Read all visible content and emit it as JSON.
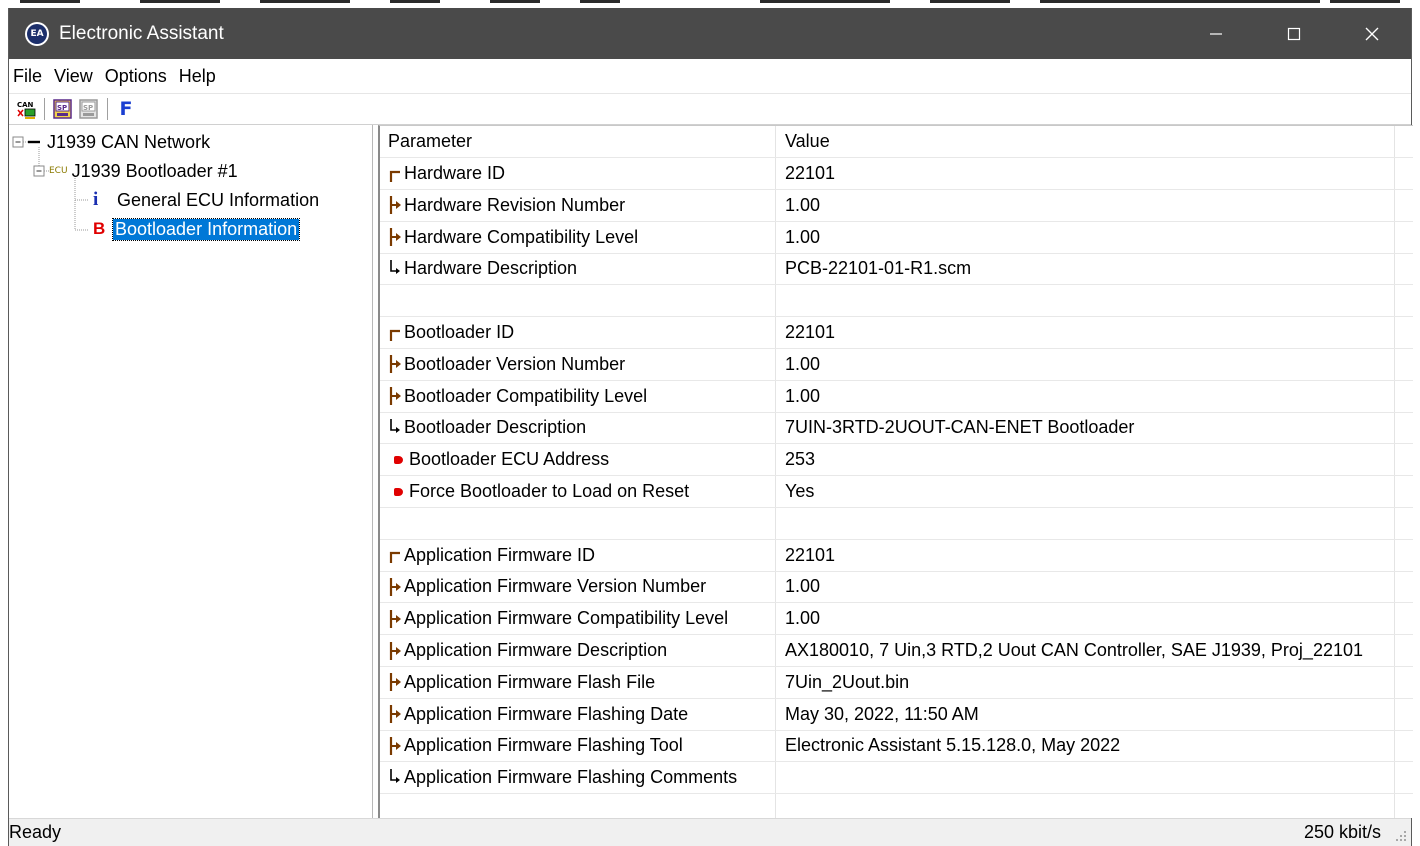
{
  "window": {
    "title": "Electronic Assistant",
    "icon_text": "EA",
    "controls": [
      "minimize-icon",
      "maximize-icon",
      "close-icon"
    ]
  },
  "menu": [
    "File",
    "View",
    "Options",
    "Help"
  ],
  "toolbar": {
    "buttons": [
      {
        "name": "can-network-icon",
        "text": "CAN"
      },
      {
        "name": "setpoint-read-icon",
        "text": "SP"
      },
      {
        "name": "setpoint-write-icon",
        "text": "SP"
      },
      {
        "name": "flash-icon",
        "text": "F"
      }
    ]
  },
  "tree": {
    "network": "J1939 CAN Network",
    "ecu_tag": "ECU",
    "ecu": "J1939 Bootloader #1",
    "general_glyph": "i",
    "general": "General ECU Information",
    "bootloader_glyph": "B",
    "bootloader": "Bootloader Information"
  },
  "table": {
    "headers": {
      "parameter": "Parameter",
      "value": "Value"
    },
    "rows": [
      {
        "glyph": "start",
        "name": "Hardware ID",
        "value": "22101"
      },
      {
        "glyph": "mid",
        "name": "Hardware Revision Number",
        "value": "1.00"
      },
      {
        "glyph": "mid",
        "name": "Hardware Compatibility Level",
        "value": "1.00"
      },
      {
        "glyph": "end",
        "name": "Hardware Description",
        "value": "PCB-22101-01-R1.scm"
      },
      {
        "glyph": "none",
        "name": "",
        "value": ""
      },
      {
        "glyph": "start",
        "name": "Bootloader ID",
        "value": "22101"
      },
      {
        "glyph": "mid",
        "name": "Bootloader Version Number",
        "value": "1.00"
      },
      {
        "glyph": "mid",
        "name": "Bootloader Compatibility Level",
        "value": "1.00"
      },
      {
        "glyph": "end",
        "name": "Bootloader Description",
        "value": "7UIN-3RTD-2UOUT-CAN-ENET Bootloader"
      },
      {
        "glyph": "red",
        "name": "Bootloader ECU Address",
        "value": "253"
      },
      {
        "glyph": "red",
        "name": "Force Bootloader to Load on Reset",
        "value": "Yes"
      },
      {
        "glyph": "none",
        "name": "",
        "value": ""
      },
      {
        "glyph": "start",
        "name": "Application Firmware ID",
        "value": "22101"
      },
      {
        "glyph": "mid",
        "name": "Application Firmware Version Number",
        "value": "1.00"
      },
      {
        "glyph": "mid",
        "name": "Application Firmware Compatibility Level",
        "value": "1.00"
      },
      {
        "glyph": "mid",
        "name": "Application Firmware Description",
        "value": "AX180010, 7 Uin,3 RTD,2 Uout CAN Controller, SAE J1939, Proj_22101"
      },
      {
        "glyph": "mid",
        "name": "Application Firmware Flash File",
        "value": "7Uin_2Uout.bin"
      },
      {
        "glyph": "mid",
        "name": "Application Firmware Flashing Date",
        "value": "May 30, 2022, 11:50 AM"
      },
      {
        "glyph": "mid",
        "name": "Application Firmware Flashing Tool",
        "value": "Electronic Assistant 5.15.128.0, May 2022"
      },
      {
        "glyph": "end",
        "name": "Application Firmware Flashing Comments",
        "value": ""
      }
    ]
  },
  "status": {
    "left": "Ready",
    "right": "250 kbit/s"
  },
  "colors": {
    "titlebar": "#4a4a4a",
    "selection": "#0078d7",
    "glyph": "#7a3a00",
    "red_dot": "#e00000",
    "flash_F": "#1a3fd1"
  }
}
